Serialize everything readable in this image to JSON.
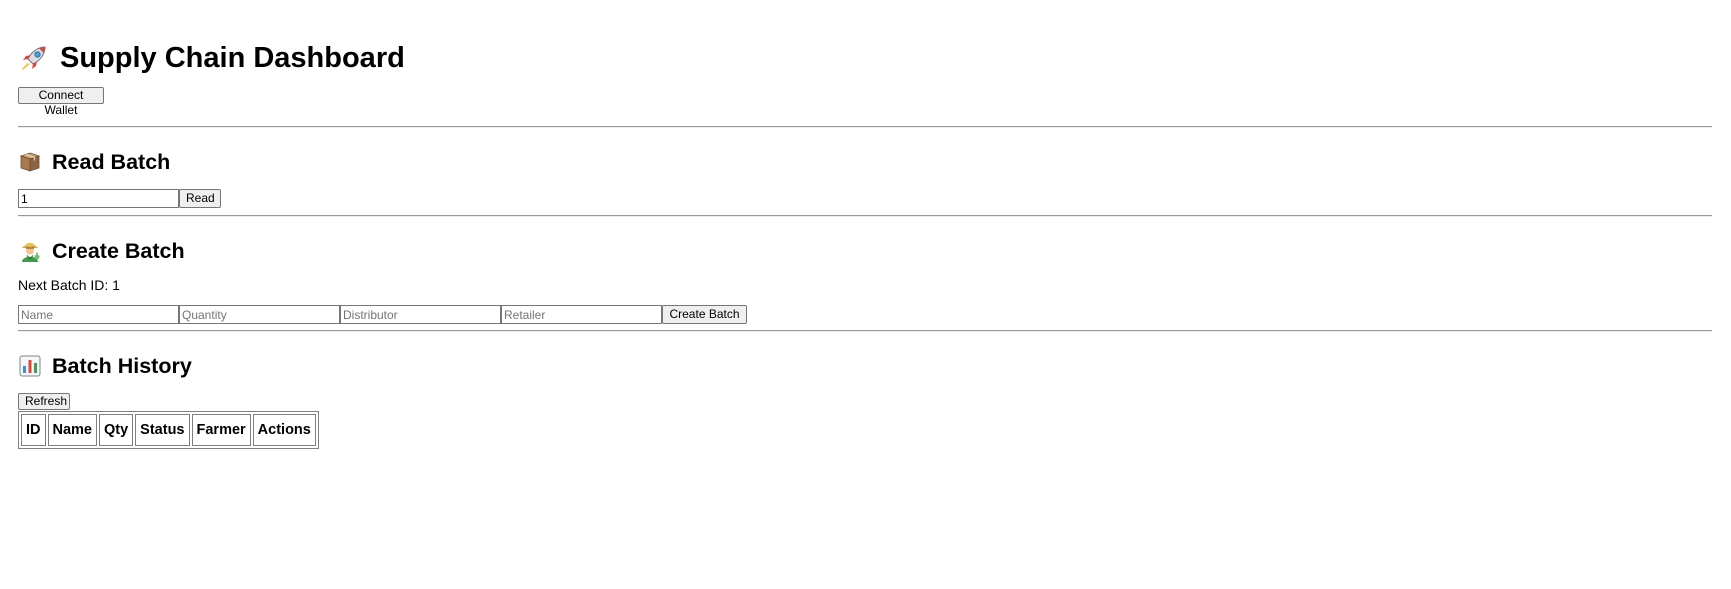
{
  "header": {
    "title": "Supply Chain Dashboard",
    "title_icon": "rocket-icon",
    "connect_wallet_label": "Connect Wallet"
  },
  "read_batch": {
    "heading": "Read Batch",
    "heading_icon": "package-icon",
    "batch_id_value": "1",
    "read_label": "Read"
  },
  "create_batch": {
    "heading": "Create Batch",
    "heading_icon": "farmer-icon",
    "next_id_text": "Next Batch ID: 1",
    "name_placeholder": "Name",
    "quantity_placeholder": "Quantity",
    "distributor_placeholder": "Distributor",
    "retailer_placeholder": "Retailer",
    "create_label": "Create Batch"
  },
  "history": {
    "heading": "Batch History",
    "heading_icon": "bar-chart-icon",
    "refresh_label": "Refresh",
    "columns": [
      "ID",
      "Name",
      "Qty",
      "Status",
      "Farmer",
      "Actions"
    ]
  }
}
